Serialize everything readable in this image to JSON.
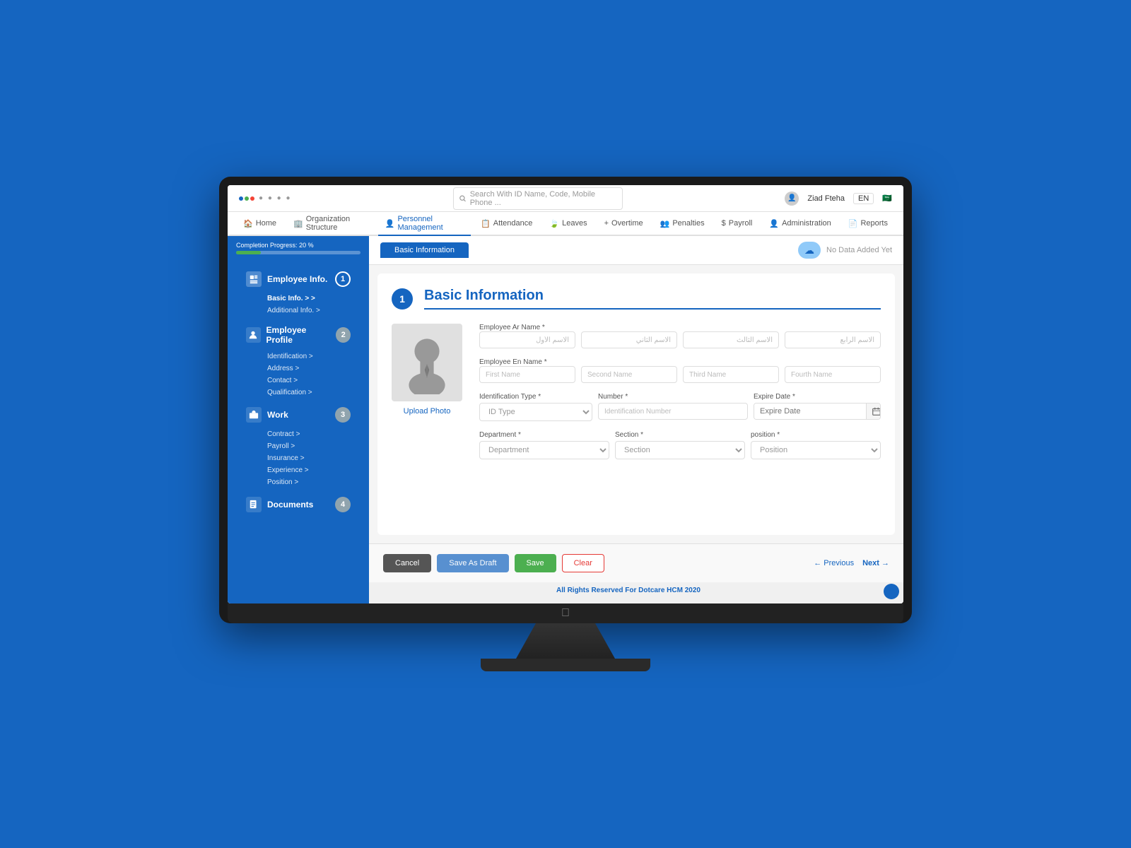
{
  "app": {
    "logo_color1": "#1565c0",
    "logo_color2": "#4caf50",
    "logo_color3": "#f44336"
  },
  "header": {
    "search_placeholder": "Search With ID Name, Code, Mobile Phone ...",
    "user_name": "Ziad Fteha",
    "lang": "EN",
    "flag_icon": "🇸🇦"
  },
  "nav": {
    "items": [
      {
        "label": "Home",
        "icon": "🏠",
        "active": false
      },
      {
        "label": "Organization Structure",
        "icon": "🏢",
        "active": false
      },
      {
        "label": "Personnel Management",
        "icon": "👤",
        "active": true
      },
      {
        "label": "Attendance",
        "icon": "📋",
        "active": false
      },
      {
        "label": "Leaves",
        "icon": "🍃",
        "active": false
      },
      {
        "label": "Overtime",
        "icon": "⏱",
        "active": false
      },
      {
        "label": "Penalties",
        "icon": "👥",
        "active": false
      },
      {
        "label": "Payroll",
        "icon": "💲",
        "active": false
      },
      {
        "label": "Administration",
        "icon": "⚙",
        "active": false
      },
      {
        "label": "Reports",
        "icon": "📄",
        "active": false
      }
    ]
  },
  "sidebar": {
    "progress_label": "Completion Progress:",
    "progress_value": "20",
    "progress_unit": "%",
    "progress_pct": 20,
    "steps": [
      {
        "number": "1",
        "title": "Employee Info.",
        "active": true,
        "sub_items": [
          {
            "label": "Basic Info.",
            "arrow": true,
            "active": true
          },
          {
            "label": "Additional Info.",
            "active": false
          }
        ]
      },
      {
        "number": "2",
        "title": "Employee Profile",
        "active": false,
        "sub_items": [
          {
            "label": "Identification"
          },
          {
            "label": "Address"
          },
          {
            "label": "Contact"
          },
          {
            "label": "Qualification"
          }
        ]
      },
      {
        "number": "3",
        "title": "Work",
        "active": false,
        "sub_items": [
          {
            "label": "Contract"
          },
          {
            "label": "Payroll"
          },
          {
            "label": "Insurance"
          },
          {
            "label": "Experience"
          },
          {
            "label": "Position"
          }
        ]
      },
      {
        "number": "4",
        "title": "Documents",
        "active": false,
        "sub_items": []
      }
    ]
  },
  "top_bar": {
    "tab_label": "Basic Information",
    "no_data_text": "No Data Added Yet"
  },
  "form": {
    "section_title": "Basic Information",
    "step_number": "1",
    "upload_photo_label": "Upload Photo",
    "fields": {
      "ar_name_label": "Employee Ar Name *",
      "ar_first_placeholder": "الاسم الأول",
      "ar_second_placeholder": "الاسم الثاني",
      "ar_third_placeholder": "الاسم الثالث",
      "ar_fourth_placeholder": "الاسم الرابع",
      "en_name_label": "Employee En Name *",
      "en_first_placeholder": "First Name",
      "en_second_placeholder": "Second Name",
      "en_third_placeholder": "Third Name",
      "en_fourth_placeholder": "Fourth Name",
      "id_type_label": "Identification Type *",
      "id_type_placeholder": "ID Type",
      "number_label": "Number *",
      "number_placeholder": "Identification Number",
      "expire_label": "Expire Date *",
      "expire_placeholder": "Expire Date",
      "department_label": "Department *",
      "department_placeholder": "Department",
      "section_label": "Section *",
      "section_placeholder": "Section",
      "position_label": "position *",
      "position_placeholder": "Position"
    }
  },
  "action_bar": {
    "cancel_label": "Cancel",
    "draft_label": "Save As Draft",
    "save_label": "Save",
    "clear_label": "Clear",
    "prev_label": "← Previous",
    "next_label": "Next →"
  },
  "footer": {
    "text": "All Rights Reserved For ",
    "brand": "Dotcare HCM",
    "year": " 2020"
  }
}
